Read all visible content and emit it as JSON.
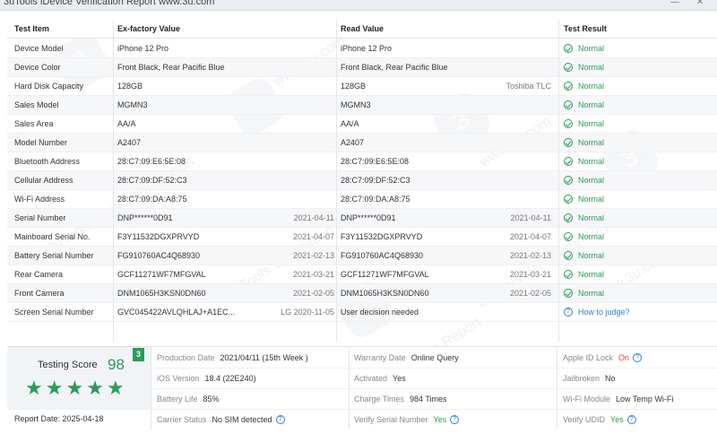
{
  "window": {
    "title": "3uTools iDevice Verification Report  www.3u.com"
  },
  "table": {
    "headers": [
      "Test Item",
      "Ex-factory Value",
      "Read Value",
      "Test Result"
    ],
    "rows": [
      {
        "item": "Device Model",
        "factory": "iPhone 12 Pro",
        "factory_date": "",
        "read": "iPhone 12 Pro",
        "read_date": "",
        "result": "Normal",
        "status": "ok"
      },
      {
        "item": "Device Color",
        "factory": "Front Black,  Rear Pacific Blue",
        "factory_date": "",
        "read": "Front Black,  Rear Pacific Blue",
        "read_date": "",
        "result": "Normal",
        "status": "ok"
      },
      {
        "item": "Hard Disk Capacity",
        "factory": "128GB",
        "factory_date": "",
        "read": "128GB",
        "read_date": "Toshiba TLC",
        "result": "Normal",
        "status": "ok"
      },
      {
        "item": "Sales Model",
        "factory": "MGMN3",
        "factory_date": "",
        "read": "MGMN3",
        "read_date": "",
        "result": "Normal",
        "status": "ok"
      },
      {
        "item": "Sales Area",
        "factory": "AA/A",
        "factory_date": "",
        "read": "AA/A",
        "read_date": "",
        "result": "Normal",
        "status": "ok"
      },
      {
        "item": "Model Number",
        "factory": "A2407",
        "factory_date": "",
        "read": "A2407",
        "read_date": "",
        "result": "Normal",
        "status": "ok"
      },
      {
        "item": "Bluetooth Address",
        "factory": "28:C7:09:E6:5E:08",
        "factory_date": "",
        "read": "28:C7:09:E6:5E:08",
        "read_date": "",
        "result": "Normal",
        "status": "ok"
      },
      {
        "item": "Cellular Address",
        "factory": "28:C7:09:DF:52:C3",
        "factory_date": "",
        "read": "28:C7:09:DF:52:C3",
        "read_date": "",
        "result": "Normal",
        "status": "ok"
      },
      {
        "item": "Wi-Fi Address",
        "factory": "28:C7:09:DA:A8:75",
        "factory_date": "",
        "read": "28:C7:09:DA:A8:75",
        "read_date": "",
        "result": "Normal",
        "status": "ok"
      },
      {
        "item": "Serial Number",
        "factory": "DNP******0D91",
        "factory_date": "2021-04-11",
        "read": "DNP******0D91",
        "read_date": "2021-04-11",
        "result": "Normal",
        "status": "ok"
      },
      {
        "item": "Mainboard Serial No.",
        "factory": "F3Y11532DGXPRVYD",
        "factory_date": "2021-04-07",
        "read": "F3Y11532DGXPRVYD",
        "read_date": "2021-04-07",
        "result": "Normal",
        "status": "ok"
      },
      {
        "item": "Battery Serial Number",
        "factory": "FG910760AC4Q68930",
        "factory_date": "2021-02-13",
        "read": "FG910760AC4Q68930",
        "read_date": "2021-02-13",
        "result": "Normal",
        "status": "ok"
      },
      {
        "item": "Rear Camera",
        "factory": "GCF11271WF7MFGVAL",
        "factory_date": "2021-03-21",
        "read": "GCF11271WF7MFGVAL",
        "read_date": "2021-03-21",
        "result": "Normal",
        "status": "ok"
      },
      {
        "item": "Front Camera",
        "factory": "DNM1065H3KSN0DN60",
        "factory_date": "2021-02-05",
        "read": "DNM1065H3KSN0DN60",
        "read_date": "2021-02-05",
        "result": "Normal",
        "status": "ok"
      },
      {
        "item": "Screen Serial Number",
        "factory": "GVC045422AVLQHLAJ+A1EC...",
        "factory_date": "LG 2020-11-05",
        "read": "User decision needed",
        "read_date": "",
        "result": "How to judge?",
        "status": "question"
      }
    ]
  },
  "score": {
    "label": "Testing Score",
    "value": "98",
    "badge": "3",
    "stars": 5,
    "report_date": "Report Date:  2025-04-18"
  },
  "info": {
    "production_date_label": "Production Date",
    "production_date_value": "2021/04/11 (15th Week )",
    "ios_version_label": "iOS Version",
    "ios_version_value": "18.4 (22E240)",
    "battery_life_label": "Battery Life",
    "battery_life_value": "85%",
    "carrier_status_label": "Carrier Status",
    "carrier_status_value": "No SIM detected",
    "warranty_date_label": "Warranty Date",
    "warranty_date_value": "Online Query",
    "activated_label": "Activated",
    "activated_value": "Yes",
    "charge_times_label": "Charge Times",
    "charge_times_value": "984 Times",
    "verify_serial_label": "Verify Serial Number",
    "verify_serial_value": "Yes",
    "apple_id_lock_label": "Apple ID Lock",
    "apple_id_lock_value": "On",
    "jailbroken_label": "Jailbroken",
    "jailbroken_value": "No",
    "wifi_module_label": "Wi-Fi Module",
    "wifi_module_value": "Low Temp Wi-Fi",
    "verify_udid_label": "Verify UDID",
    "verify_udid_value": "Yes"
  },
  "watermark": {
    "text": "3uTools Verification Report",
    "url": "www.3u.com",
    "logo": "3"
  },
  "colors": {
    "normal": "#2c9a5a",
    "link": "#2d7fd8",
    "alert": "#e23c3c"
  }
}
